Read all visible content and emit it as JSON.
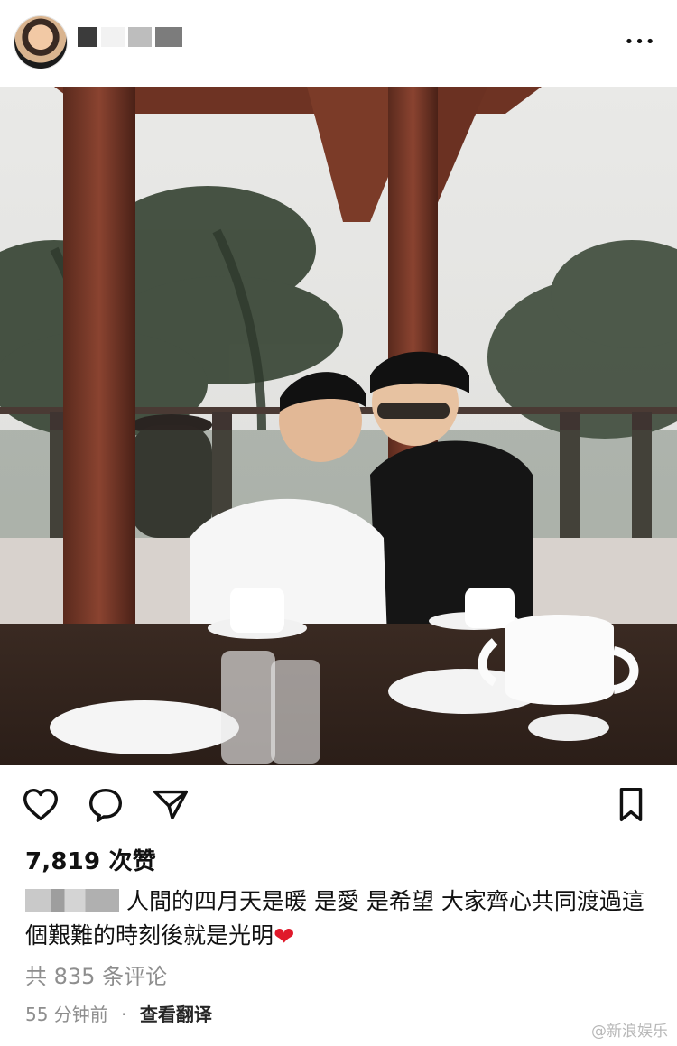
{
  "post": {
    "likes_text": "7,819 次赞",
    "caption_text": "人間的四月天是暖 是愛 是希望 大家齊心共同渡過這個艱難的時刻後就是光明",
    "caption_emoji": "❤",
    "comments_text": "共 835 条评论",
    "time_text": "55 分钟前",
    "separator": "·",
    "translate_text": "查看翻译"
  },
  "header": {
    "more_text": "•••"
  },
  "watermark": {
    "text": "@新浪娱乐"
  },
  "icons": {
    "like": "heart-icon",
    "comment": "comment-icon",
    "share": "send-icon",
    "save": "bookmark-icon",
    "more": "more-icon"
  },
  "colors": {
    "text": "#111111",
    "muted": "#8e8e8e",
    "heart_emoji": "#e0192a"
  }
}
